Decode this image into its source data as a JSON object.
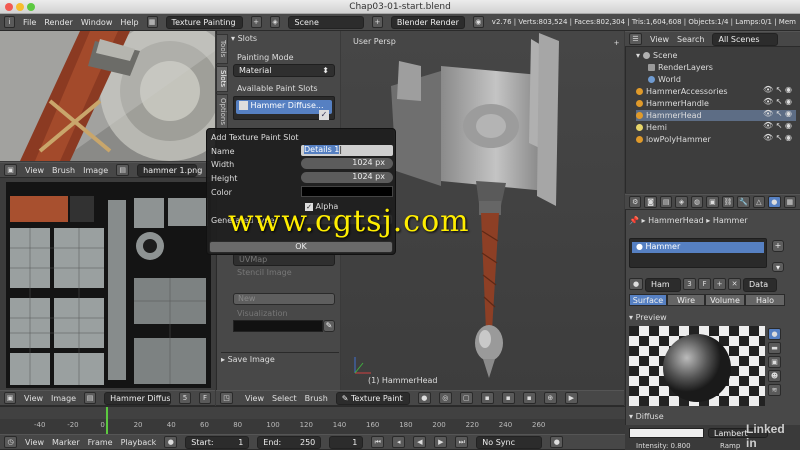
{
  "window": {
    "title": "Chap03-01-start.blend"
  },
  "menubar": {
    "items": [
      "File",
      "Render",
      "Window",
      "Help"
    ],
    "mode": "Texture Painting",
    "scene": "Scene",
    "engine": "Blender Render",
    "stats": "v2.76 | Verts:803,524 | Faces:802,304 | Tris:1,604,608 | Objects:1/4 | Lamps:0/1 | Mem"
  },
  "slots_panel": {
    "tabs": [
      "Tools",
      "Slots",
      "Options"
    ],
    "title": "Slots",
    "painting_mode_label": "Painting Mode",
    "painting_mode": "Material",
    "available_label": "Available Paint Slots",
    "slot_name": "Hammer Diffuse...",
    "uv_value": "UVMap",
    "stencil_label": "Stencil Image",
    "new_label": "New",
    "visualization_label": "Visualization",
    "save_image": "Save Image"
  },
  "dialog": {
    "title": "Add Texture Paint Slot",
    "name_label": "Name",
    "name_value": "Details 1",
    "width_label": "Width",
    "width_value": "1024 px",
    "height_label": "Height",
    "height_value": "1024 px",
    "color_label": "Color",
    "alpha_label": "Alpha",
    "generated_label": "Generated Type",
    "ok": "OK"
  },
  "uv_header": {
    "items": [
      "View",
      "Brush",
      "Image"
    ],
    "image": "hammer 1.png"
  },
  "bottom_header": {
    "items": [
      "View",
      "Image"
    ],
    "image": "Hammer Diffuse C...",
    "num": "5",
    "f": "F"
  },
  "view3d": {
    "label": "User Persp",
    "object": "(1) HammerHead",
    "header": [
      "View",
      "Select",
      "Brush"
    ],
    "mode": "Texture Paint"
  },
  "outliner": {
    "header": [
      "View",
      "Search"
    ],
    "filter": "All Scenes",
    "rows": [
      "Scene",
      "RenderLayers",
      "World",
      "HammerAccessories",
      "HammerHandle",
      "HammerHead",
      "Hemi",
      "lowPolyHammer"
    ],
    "colors": {
      "scene": "#b0b0b0",
      "layers": "#9a9a9a",
      "world": "#6f9bd1",
      "mesh": "#e09a2a",
      "lamp": "#e8d66a"
    }
  },
  "properties": {
    "breadcrumb_1": "HammerHead",
    "breadcrumb_2": "Hammer",
    "material": "Hammer",
    "mat_short": "Ham",
    "users": "3",
    "f": "F",
    "data": "Data",
    "tabs": [
      "Surface",
      "Wire",
      "Volume",
      "Halo"
    ],
    "preview": "Preview",
    "diffuse": "Diffuse",
    "lambert": "Lambert",
    "intensity": "Intensity: 0.800",
    "ramp": "Ramp"
  },
  "timeline": {
    "ticks": [
      "-40",
      "-20",
      "0",
      "20",
      "40",
      "60",
      "80",
      "100",
      "120",
      "140",
      "160",
      "180",
      "200",
      "220",
      "240",
      "260"
    ],
    "items": [
      "View",
      "Marker",
      "Frame",
      "Playback"
    ],
    "start": "Start:",
    "start_val": "1",
    "end": "End:",
    "end_val": "250",
    "current": "1",
    "sync": "No Sync"
  },
  "watermark": "www.cgtsj.com",
  "brand": "Linked in"
}
